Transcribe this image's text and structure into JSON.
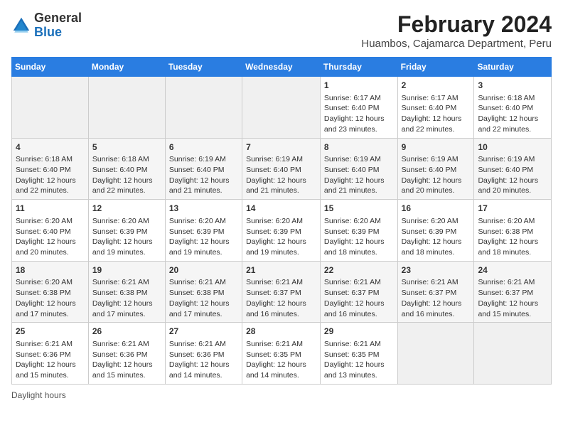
{
  "logo": {
    "general": "General",
    "blue": "Blue"
  },
  "title": "February 2024",
  "subtitle": "Huambos, Cajamarca Department, Peru",
  "days_of_week": [
    "Sunday",
    "Monday",
    "Tuesday",
    "Wednesday",
    "Thursday",
    "Friday",
    "Saturday"
  ],
  "weeks": [
    [
      {
        "day": "",
        "info": ""
      },
      {
        "day": "",
        "info": ""
      },
      {
        "day": "",
        "info": ""
      },
      {
        "day": "",
        "info": ""
      },
      {
        "day": "1",
        "info": "Sunrise: 6:17 AM\nSunset: 6:40 PM\nDaylight: 12 hours\nand 23 minutes."
      },
      {
        "day": "2",
        "info": "Sunrise: 6:17 AM\nSunset: 6:40 PM\nDaylight: 12 hours\nand 22 minutes."
      },
      {
        "day": "3",
        "info": "Sunrise: 6:18 AM\nSunset: 6:40 PM\nDaylight: 12 hours\nand 22 minutes."
      }
    ],
    [
      {
        "day": "4",
        "info": "Sunrise: 6:18 AM\nSunset: 6:40 PM\nDaylight: 12 hours\nand 22 minutes."
      },
      {
        "day": "5",
        "info": "Sunrise: 6:18 AM\nSunset: 6:40 PM\nDaylight: 12 hours\nand 22 minutes."
      },
      {
        "day": "6",
        "info": "Sunrise: 6:19 AM\nSunset: 6:40 PM\nDaylight: 12 hours\nand 21 minutes."
      },
      {
        "day": "7",
        "info": "Sunrise: 6:19 AM\nSunset: 6:40 PM\nDaylight: 12 hours\nand 21 minutes."
      },
      {
        "day": "8",
        "info": "Sunrise: 6:19 AM\nSunset: 6:40 PM\nDaylight: 12 hours\nand 21 minutes."
      },
      {
        "day": "9",
        "info": "Sunrise: 6:19 AM\nSunset: 6:40 PM\nDaylight: 12 hours\nand 20 minutes."
      },
      {
        "day": "10",
        "info": "Sunrise: 6:19 AM\nSunset: 6:40 PM\nDaylight: 12 hours\nand 20 minutes."
      }
    ],
    [
      {
        "day": "11",
        "info": "Sunrise: 6:20 AM\nSunset: 6:40 PM\nDaylight: 12 hours\nand 20 minutes."
      },
      {
        "day": "12",
        "info": "Sunrise: 6:20 AM\nSunset: 6:39 PM\nDaylight: 12 hours\nand 19 minutes."
      },
      {
        "day": "13",
        "info": "Sunrise: 6:20 AM\nSunset: 6:39 PM\nDaylight: 12 hours\nand 19 minutes."
      },
      {
        "day": "14",
        "info": "Sunrise: 6:20 AM\nSunset: 6:39 PM\nDaylight: 12 hours\nand 19 minutes."
      },
      {
        "day": "15",
        "info": "Sunrise: 6:20 AM\nSunset: 6:39 PM\nDaylight: 12 hours\nand 18 minutes."
      },
      {
        "day": "16",
        "info": "Sunrise: 6:20 AM\nSunset: 6:39 PM\nDaylight: 12 hours\nand 18 minutes."
      },
      {
        "day": "17",
        "info": "Sunrise: 6:20 AM\nSunset: 6:38 PM\nDaylight: 12 hours\nand 18 minutes."
      }
    ],
    [
      {
        "day": "18",
        "info": "Sunrise: 6:20 AM\nSunset: 6:38 PM\nDaylight: 12 hours\nand 17 minutes."
      },
      {
        "day": "19",
        "info": "Sunrise: 6:21 AM\nSunset: 6:38 PM\nDaylight: 12 hours\nand 17 minutes."
      },
      {
        "day": "20",
        "info": "Sunrise: 6:21 AM\nSunset: 6:38 PM\nDaylight: 12 hours\nand 17 minutes."
      },
      {
        "day": "21",
        "info": "Sunrise: 6:21 AM\nSunset: 6:37 PM\nDaylight: 12 hours\nand 16 minutes."
      },
      {
        "day": "22",
        "info": "Sunrise: 6:21 AM\nSunset: 6:37 PM\nDaylight: 12 hours\nand 16 minutes."
      },
      {
        "day": "23",
        "info": "Sunrise: 6:21 AM\nSunset: 6:37 PM\nDaylight: 12 hours\nand 16 minutes."
      },
      {
        "day": "24",
        "info": "Sunrise: 6:21 AM\nSunset: 6:37 PM\nDaylight: 12 hours\nand 15 minutes."
      }
    ],
    [
      {
        "day": "25",
        "info": "Sunrise: 6:21 AM\nSunset: 6:36 PM\nDaylight: 12 hours\nand 15 minutes."
      },
      {
        "day": "26",
        "info": "Sunrise: 6:21 AM\nSunset: 6:36 PM\nDaylight: 12 hours\nand 15 minutes."
      },
      {
        "day": "27",
        "info": "Sunrise: 6:21 AM\nSunset: 6:36 PM\nDaylight: 12 hours\nand 14 minutes."
      },
      {
        "day": "28",
        "info": "Sunrise: 6:21 AM\nSunset: 6:35 PM\nDaylight: 12 hours\nand 14 minutes."
      },
      {
        "day": "29",
        "info": "Sunrise: 6:21 AM\nSunset: 6:35 PM\nDaylight: 12 hours\nand 13 minutes."
      },
      {
        "day": "",
        "info": ""
      },
      {
        "day": "",
        "info": ""
      }
    ]
  ],
  "footer": "Daylight hours"
}
